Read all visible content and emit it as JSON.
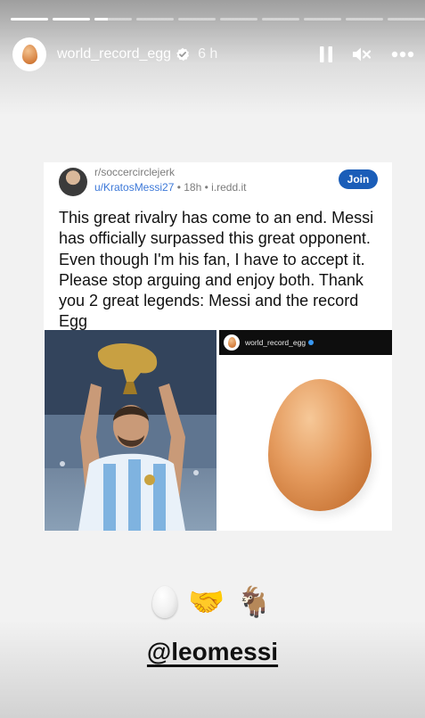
{
  "progress": {
    "segments": [
      1,
      1,
      0.35,
      0,
      0,
      0,
      0,
      0,
      0,
      0
    ]
  },
  "header": {
    "username": "world_record_egg",
    "time": "6 h",
    "icons": [
      "pause-icon",
      "mute-icon",
      "more-icon"
    ]
  },
  "post": {
    "subreddit": "r/soccercirclejerk",
    "user": "u/KratosMessi27",
    "meta": " • 18h • i.redd.it",
    "join_label": "Join",
    "text": "This great rivalry has come to an end. Messi has officially surpassed this great opponent. Even though I'm his fan, I have to accept it. Please stop arguing and enjoy both. Thank you 2 great legends: Messi and the record Egg",
    "egg_screenshot_name": "world_record_egg"
  },
  "stickers": {
    "emojis": [
      "🤝",
      "🐐"
    ]
  },
  "mention": "@leomessi",
  "colors": {
    "join": "#1a5db8",
    "verified": "#3897f0",
    "egg": "#d6803f"
  }
}
